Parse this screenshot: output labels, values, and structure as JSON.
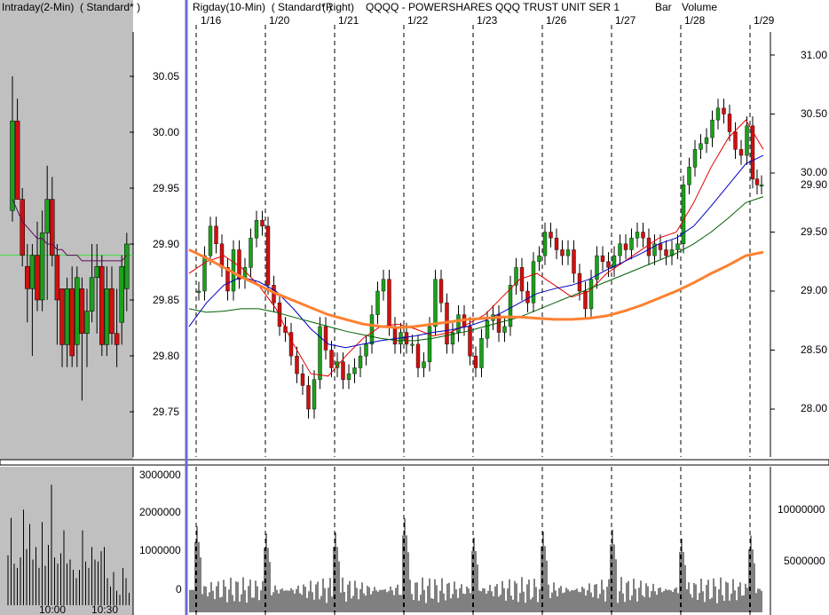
{
  "header": {
    "left_title": "Intraday(2-Min)  ( Standard* )",
    "right_title": "Rigday(10-Min)  ( Standard* )",
    "axis_side": "(Right)",
    "symbol": "QQQQ - POWERSHARES QQQ TRUST UNIT SER 1",
    "bar_label": "Bar",
    "volume_label": "Volume"
  },
  "colors": {
    "up_candle": "#1ca01c",
    "down_candle": "#d01010",
    "left_panel_bg": "#c0c0c0",
    "ma_fast": "#e00000",
    "ma_mid": "#0000c0",
    "ma_slow": "#006000",
    "ma_long": "#ff8030",
    "divider": "#6a6ad8"
  },
  "chart_data": [
    {
      "id": "intraday",
      "type": "candlestick",
      "title": "Intraday(2-Min)",
      "ylim": [
        29.7,
        30.1
      ],
      "yticks": [
        "30.05",
        "30.00",
        "29.95",
        "29.90",
        "29.85",
        "29.80",
        "29.75"
      ],
      "xticks": [
        "10:00",
        "10:30"
      ],
      "reference_level": 29.89,
      "candles": [
        {
          "o": 29.93,
          "h": 30.05,
          "l": 29.92,
          "c": 30.01
        },
        {
          "o": 30.01,
          "h": 30.03,
          "l": 29.94,
          "c": 29.94
        },
        {
          "o": 29.94,
          "h": 29.95,
          "l": 29.88,
          "c": 29.89
        },
        {
          "o": 29.88,
          "h": 29.9,
          "l": 29.83,
          "c": 29.86
        },
        {
          "o": 29.86,
          "h": 29.9,
          "l": 29.8,
          "c": 29.89
        },
        {
          "o": 29.89,
          "h": 29.92,
          "l": 29.84,
          "c": 29.85
        },
        {
          "o": 29.85,
          "h": 29.93,
          "l": 29.84,
          "c": 29.91
        },
        {
          "o": 29.91,
          "h": 29.97,
          "l": 29.85,
          "c": 29.94
        },
        {
          "o": 29.94,
          "h": 29.96,
          "l": 29.88,
          "c": 29.89
        },
        {
          "o": 29.89,
          "h": 29.9,
          "l": 29.81,
          "c": 29.85
        },
        {
          "o": 29.86,
          "h": 29.86,
          "l": 29.79,
          "c": 29.81
        },
        {
          "o": 29.81,
          "h": 29.87,
          "l": 29.79,
          "c": 29.86
        },
        {
          "o": 29.86,
          "h": 29.88,
          "l": 29.79,
          "c": 29.8
        },
        {
          "o": 29.81,
          "h": 29.88,
          "l": 29.79,
          "c": 29.87
        },
        {
          "o": 29.86,
          "h": 29.87,
          "l": 29.76,
          "c": 29.82
        },
        {
          "o": 29.82,
          "h": 29.86,
          "l": 29.79,
          "c": 29.84
        },
        {
          "o": 29.84,
          "h": 29.9,
          "l": 29.83,
          "c": 29.87
        },
        {
          "o": 29.87,
          "h": 29.9,
          "l": 29.82,
          "c": 29.88
        },
        {
          "o": 29.88,
          "h": 29.89,
          "l": 29.8,
          "c": 29.81
        },
        {
          "o": 29.81,
          "h": 29.88,
          "l": 29.8,
          "c": 29.86
        },
        {
          "o": 29.86,
          "h": 29.88,
          "l": 29.81,
          "c": 29.82
        },
        {
          "o": 29.82,
          "h": 29.86,
          "l": 29.79,
          "c": 29.81
        },
        {
          "o": 29.83,
          "h": 29.89,
          "l": 29.81,
          "c": 29.88
        },
        {
          "o": 29.86,
          "h": 29.91,
          "l": 29.84,
          "c": 29.9
        }
      ],
      "ma": [
        29.94,
        29.93,
        29.92,
        29.915,
        29.91,
        29.905,
        29.905,
        29.9,
        29.9,
        29.895,
        29.895,
        29.89,
        29.89,
        29.89,
        29.885,
        29.885,
        29.885,
        29.885,
        29.885,
        29.885,
        29.885,
        29.885,
        29.885,
        29.89
      ],
      "volume": {
        "yticks": [
          "3000000",
          "2000000",
          "1000000",
          "0"
        ],
        "ylim": [
          0,
          3200000
        ],
        "values": [
          1200000,
          2100000,
          1000000,
          900000,
          1150000,
          2300000,
          1350000,
          1950000,
          1100000,
          1400000,
          900000,
          2000000,
          950000,
          1450000,
          2900000,
          1150000,
          1000000,
          1250000,
          1800000,
          1000000,
          1100000,
          850000,
          650000,
          850000,
          1800000,
          1050000,
          900000,
          1400000,
          1100000,
          1050000,
          1300000,
          1400000,
          650000,
          450000,
          800000,
          350000,
          250000,
          900000,
          650000,
          300000
        ]
      }
    },
    {
      "id": "rigday",
      "type": "candlestick",
      "title": "Rigday(10-Min)",
      "ylim": [
        27.55,
        31.25
      ],
      "yticks": [
        "31.00",
        "30.50",
        "30.00",
        "29.50",
        "29.00",
        "28.50",
        "28.00"
      ],
      "last_price_label": "29.90",
      "days": [
        {
          "label": "1/16",
          "values": [
            29.0,
            29.3,
            29.55,
            29.4,
            29.2,
            29.0,
            29.35,
            29.1,
            29.2,
            29.45,
            29.6,
            29.55
          ]
        },
        {
          "label": "1/20",
          "values": [
            29.05,
            28.9,
            28.7,
            28.65,
            28.45,
            28.3,
            28.2,
            28.0,
            28.25,
            28.7,
            28.5,
            28.35
          ]
        },
        {
          "label": "1/21",
          "values": [
            28.4,
            28.25,
            28.3,
            28.35,
            28.45,
            28.55,
            28.8,
            29.0,
            29.1,
            28.7,
            28.55,
            28.65
          ]
        },
        {
          "label": "1/22",
          "values": [
            28.55,
            28.55,
            28.35,
            28.4,
            28.7,
            29.1,
            28.9,
            28.55,
            28.65,
            28.8,
            28.7,
            28.45
          ]
        },
        {
          "label": "1/23",
          "values": [
            28.35,
            28.6,
            28.75,
            28.8,
            28.65,
            28.7,
            29.05,
            29.2,
            29.0,
            28.9,
            29.25,
            29.3
          ]
        },
        {
          "label": "1/26",
          "values": [
            29.5,
            29.45,
            29.35,
            29.3,
            29.35,
            29.15,
            29.0,
            28.85,
            29.1,
            29.3,
            29.25,
            29.2
          ]
        },
        {
          "label": "1/27",
          "values": [
            29.3,
            29.4,
            29.35,
            29.45,
            29.5,
            29.45,
            29.3,
            29.4,
            29.35,
            29.3,
            29.35,
            29.4
          ]
        },
        {
          "label": "1/28",
          "values": [
            29.9,
            30.05,
            30.2,
            30.25,
            30.3,
            30.45,
            30.55,
            30.5,
            30.35,
            30.2,
            30.15,
            30.4
          ]
        },
        {
          "label": "1/29",
          "values": [
            29.95,
            29.9,
            29.9
          ]
        }
      ],
      "moving_averages": [
        {
          "color_key": "ma_fast",
          "values": [
            29.15,
            29.25,
            29.3,
            29.2,
            29.05,
            28.85,
            28.55,
            28.3,
            28.28,
            28.45,
            28.6,
            28.7,
            28.72,
            28.68,
            28.62,
            28.65,
            28.72,
            28.8,
            28.95,
            29.1,
            29.15,
            29.05,
            28.95,
            29.0,
            29.15,
            29.25,
            29.35,
            29.45,
            29.5,
            29.75,
            30.05,
            30.3,
            30.45,
            30.2
          ]
        },
        {
          "color_key": "ma_mid",
          "values": [
            28.7,
            28.9,
            29.05,
            29.12,
            29.08,
            29.0,
            28.85,
            28.68,
            28.55,
            28.52,
            28.55,
            28.58,
            28.6,
            28.62,
            28.65,
            28.67,
            28.7,
            28.75,
            28.82,
            28.9,
            28.98,
            29.02,
            29.05,
            29.1,
            29.18,
            29.25,
            29.32,
            29.4,
            29.45,
            29.55,
            29.72,
            29.9,
            30.08,
            30.15
          ]
        },
        {
          "color_key": "ma_slow",
          "values": [
            28.85,
            28.82,
            28.83,
            28.85,
            28.85,
            28.82,
            28.78,
            28.74,
            28.7,
            28.66,
            28.63,
            28.6,
            28.58,
            28.58,
            28.6,
            28.63,
            28.66,
            28.7,
            28.74,
            28.78,
            28.84,
            28.9,
            28.96,
            29.02,
            29.08,
            29.14,
            29.2,
            29.26,
            29.32,
            29.4,
            29.5,
            29.62,
            29.75,
            29.8
          ]
        },
        {
          "color_key": "ma_long",
          "values": [
            29.35,
            29.28,
            29.2,
            29.12,
            29.05,
            28.98,
            28.92,
            28.86,
            28.8,
            28.76,
            28.72,
            28.7,
            28.69,
            28.7,
            28.72,
            28.74,
            28.76,
            28.77,
            28.78,
            28.78,
            28.77,
            28.76,
            28.76,
            28.77,
            28.79,
            28.83,
            28.88,
            28.94,
            29.0,
            29.07,
            29.15,
            29.22,
            29.3,
            29.33
          ]
        }
      ],
      "volume": {
        "yticks": [
          "10000000",
          "5000000"
        ],
        "ylim": [
          0,
          14500000
        ],
        "day_spike_values": [
          8500000,
          7800000,
          7900000,
          9300000,
          7400000,
          8000000,
          8200000,
          7300000,
          7600000
        ]
      }
    }
  ]
}
